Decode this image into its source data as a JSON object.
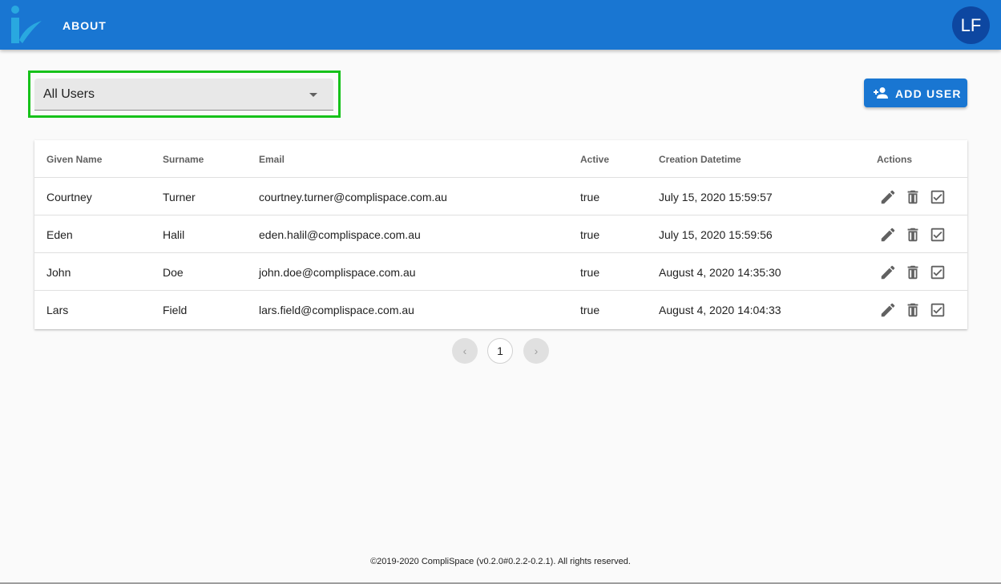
{
  "appbar": {
    "nav_label": "ABOUT",
    "avatar_initials": "LF",
    "color": "#1976d2"
  },
  "filter": {
    "selected_value": "All Users"
  },
  "toolbar": {
    "add_user_label": "ADD USER",
    "add_user_icon": "person-add-icon"
  },
  "table": {
    "headers": {
      "given_name": "Given Name",
      "surname": "Surname",
      "email": "Email",
      "active": "Active",
      "creation_datetime": "Creation Datetime",
      "actions": "Actions"
    },
    "rows": [
      {
        "given_name": "Courtney",
        "surname": "Turner",
        "email": "courtney.turner@complispace.com.au",
        "active": "true",
        "creation_datetime": "July 15, 2020 15:59:57"
      },
      {
        "given_name": "Eden",
        "surname": "Halil",
        "email": "eden.halil@complispace.com.au",
        "active": "true",
        "creation_datetime": "July 15, 2020 15:59:56"
      },
      {
        "given_name": "John",
        "surname": "Doe",
        "email": "john.doe@complispace.com.au",
        "active": "true",
        "creation_datetime": "August 4, 2020 14:35:30"
      },
      {
        "given_name": "Lars",
        "surname": "Field",
        "email": "lars.field@complispace.com.au",
        "active": "true",
        "creation_datetime": "August 4, 2020 14:04:33"
      }
    ],
    "row_action_icons": [
      "pencil-icon",
      "trash-icon",
      "checkbox-checked-icon"
    ]
  },
  "pagination": {
    "prev_symbol": "‹",
    "current_page": "1",
    "next_symbol": "›"
  },
  "footer": {
    "text": "©2019-2020 CompliSpace (v0.2.0#0.2.2-0.2.1). All rights reserved."
  },
  "colors": {
    "highlight_outline": "#16c21a",
    "avatar_bg": "#0d47a1"
  }
}
